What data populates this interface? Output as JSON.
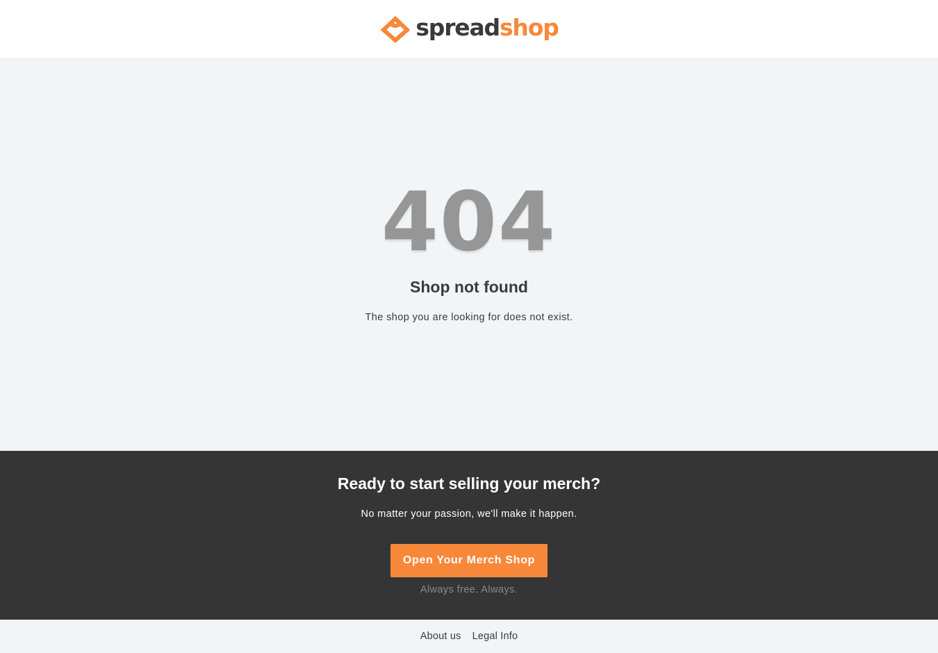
{
  "header": {
    "logo": {
      "word_part_1": "spread",
      "word_part_2": "shop",
      "icon": "heart-diamond-icon"
    }
  },
  "error": {
    "code": "404",
    "title": "Shop not found",
    "message": "The shop you are looking for does not exist."
  },
  "promo": {
    "title": "Ready to start selling your merch?",
    "subtitle": "No matter your passion, we'll make it happen.",
    "button_label": "Open Your Merch Shop",
    "note": "Always free. Always."
  },
  "footer": {
    "links": [
      {
        "label": "About us"
      },
      {
        "label": "Legal Info"
      }
    ]
  },
  "colors": {
    "accent": "#f7883a",
    "dark_band": "#353535",
    "page_background": "#f2f5f7",
    "error_code": "#969696"
  }
}
